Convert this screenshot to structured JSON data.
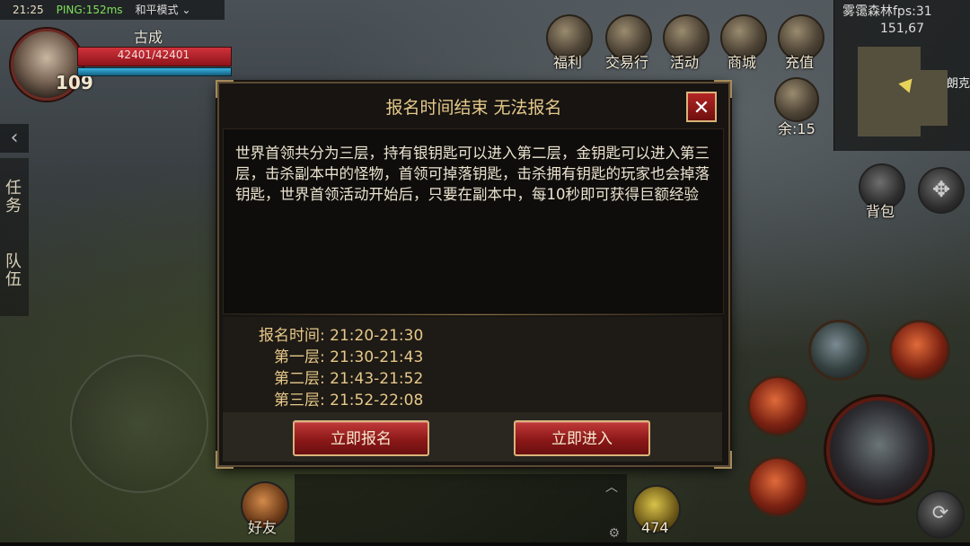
{
  "status_bar": {
    "time": "21:25",
    "ping": "PING:152ms",
    "mode": "和平模式"
  },
  "player": {
    "name": "古成",
    "level": "109",
    "hp": "42401/42401"
  },
  "top_menu": [
    {
      "label": "福利",
      "icon": "gift-chest-icon"
    },
    {
      "label": "交易行",
      "icon": "handshake-icon"
    },
    {
      "label": "活动",
      "icon": "event-number-7-icon"
    },
    {
      "label": "商城",
      "icon": "shop-stall-icon"
    },
    {
      "label": "充值",
      "icon": "gem-pouch-icon"
    }
  ],
  "minimap": {
    "name": "雾霭森林fps:31",
    "coords": "151,67",
    "zone_label": "朗克"
  },
  "boss_chest": {
    "label": "余:15",
    "icon": "skull-chest-icon"
  },
  "bag": {
    "label": "背包",
    "icon": "backpack-icon"
  },
  "side_tabs": {
    "quest": "任务",
    "team": "队伍"
  },
  "friends": {
    "label": "好友",
    "icon": "friends-icon"
  },
  "potion": {
    "count": "474",
    "icon": "potion-icon"
  },
  "dialog": {
    "title": "报名时间结束 无法报名",
    "description": "世界首领共分为三层，持有银钥匙可以进入第二层，金钥匙可以进入第三层，击杀副本中的怪物，首领可掉落钥匙，击杀拥有钥匙的玩家也会掉落钥匙，世界首领活动开始后，只要在副本中，每10秒即可获得巨额经验",
    "schedule": [
      {
        "label": "报名时间",
        "time": "21:20-21:30"
      },
      {
        "label": "第一层",
        "time": "21:30-21:43"
      },
      {
        "label": "第二层",
        "time": "21:43-21:52"
      },
      {
        "label": "第三层",
        "time": "21:52-22:08"
      }
    ],
    "separator": ":",
    "signup_button": "立即报名",
    "enter_button": "立即进入",
    "close_glyph": "✕"
  },
  "colors": {
    "accent_gold": "#e6c98a",
    "button_red": "#8c1818",
    "hp_red": "#d0323a",
    "mp_blue": "#3bb3e3",
    "ping_green": "#7ee05a"
  }
}
